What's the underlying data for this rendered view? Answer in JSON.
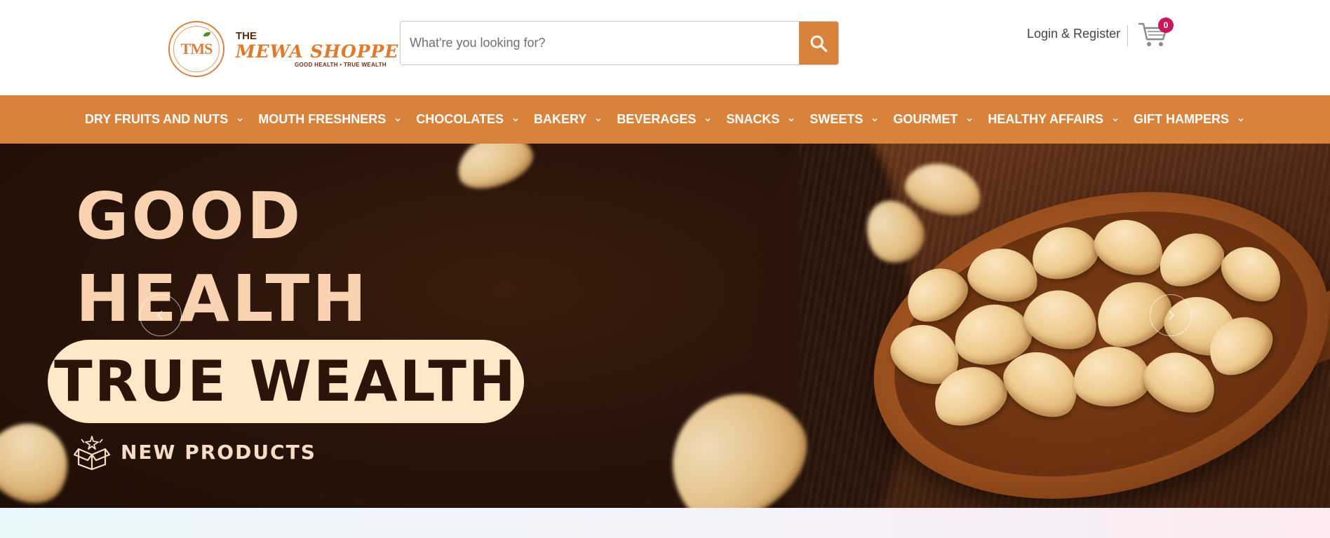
{
  "brand": {
    "seal_text": "TMS",
    "the": "THE",
    "name": "MEWA SHOPPE",
    "tagline": "GOOD HEALTH • TRUE WEALTH"
  },
  "search": {
    "placeholder": "What're you looking for?",
    "value": "",
    "icon": "search-icon"
  },
  "header": {
    "login_label": "Login & Register",
    "cart_icon": "cart-icon",
    "cart_count": "0"
  },
  "nav": {
    "items": [
      {
        "label": "DRY FRUITS AND NUTS"
      },
      {
        "label": "MOUTH FRESHNERS"
      },
      {
        "label": "CHOCOLATES"
      },
      {
        "label": "BAKERY"
      },
      {
        "label": "BEVERAGES"
      },
      {
        "label": "SNACKS"
      },
      {
        "label": "SWEETS"
      },
      {
        "label": "GOURMET"
      },
      {
        "label": "HEALTHY AFFAIRS"
      },
      {
        "label": "GIFT HAMPERS"
      }
    ]
  },
  "hero": {
    "line1": "GOOD",
    "line2": "HEALTH",
    "pill": "TRUE WEALTH",
    "cta": "NEW PRODUCTS",
    "cta_icon": "gift-box-icon"
  },
  "colors": {
    "accent": "#d9823c",
    "badge": "#c8175d",
    "hero_bg": "#2b150a",
    "hero_text": "#f9d3b1",
    "pill_bg": "#fde8c8"
  }
}
